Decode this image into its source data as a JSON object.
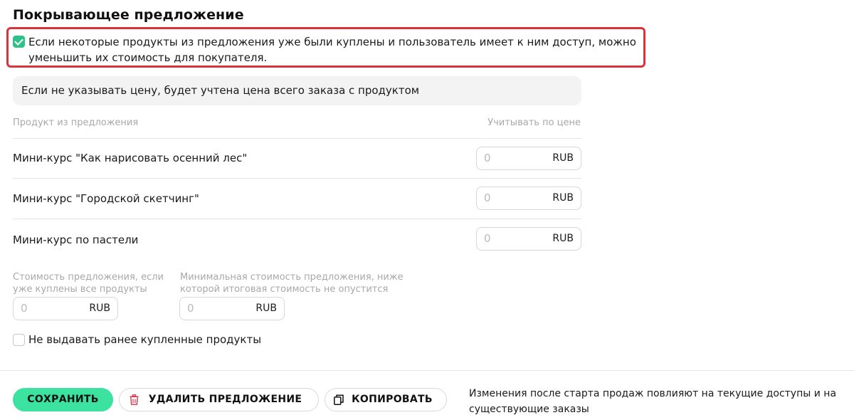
{
  "section": {
    "title": "Покрывающее предложение"
  },
  "discount_option": {
    "checked": true,
    "label": "Если некоторые продукты из предложения уже были куплены и пользователь имеет к ним доступ, можно уменьшить их стоимость для покупателя."
  },
  "note": "Если не указывать цену, будет учтена цена всего заказа с продуктом",
  "table": {
    "columns": [
      "Продукт из предложения",
      "Учитывать по цене"
    ],
    "rows": [
      {
        "name": "Мини-курс \"Как нарисовать осенний лес\"",
        "price_placeholder": "0",
        "currency": "RUB"
      },
      {
        "name": "Мини-курс \"Городской скетчинг\"",
        "price_placeholder": "0",
        "currency": "RUB"
      },
      {
        "name": "Мини-курс по пастели",
        "price_placeholder": "0",
        "currency": "RUB"
      }
    ]
  },
  "fields": {
    "all_bought": {
      "label": "Стоимость предложения, если уже куплены все продукты",
      "placeholder": "0",
      "currency": "RUB"
    },
    "min_cost": {
      "label": "Минимальная стоимость предложения, ниже которой итоговая стоимость не опустится",
      "placeholder": "0",
      "currency": "RUB"
    }
  },
  "no_give_option": {
    "checked": false,
    "label": "Не выдавать ранее купленные продукты"
  },
  "footer": {
    "save_label": "СОХРАНИТЬ",
    "delete_label": "УДАЛИТЬ ПРЕДЛОЖЕНИЕ",
    "copy_label": "КОПИРОВАТЬ",
    "note": "Изменения после старта продаж повлияют на текущие доступы и на существующие заказы"
  },
  "colors": {
    "accent": "#3ce2a0",
    "checkbox": "#2ec28b",
    "highlight": "#d9343a",
    "danger_icon": "#e0364a"
  },
  "icons": {
    "delete": "trash-icon",
    "copy": "copy-icon",
    "check": "check-icon"
  }
}
